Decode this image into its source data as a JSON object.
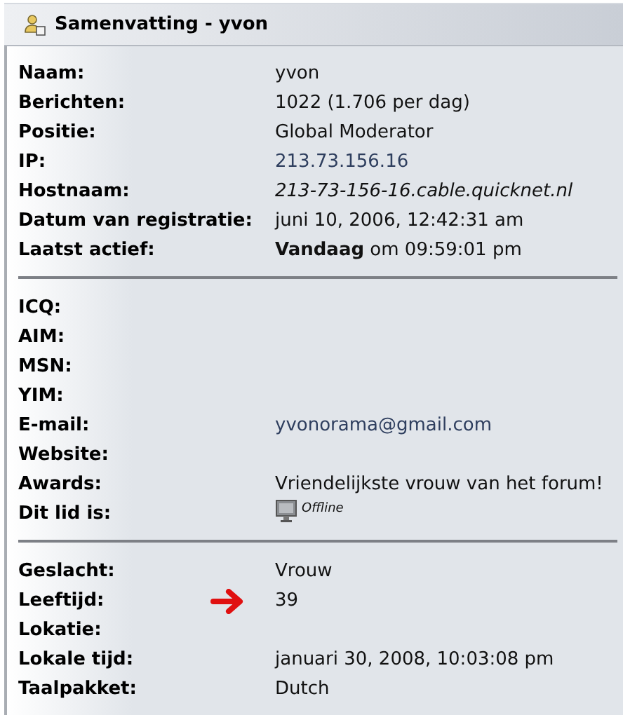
{
  "panel": {
    "title": "Samenvatting - yvon"
  },
  "sections": [
    {
      "rows": [
        {
          "label": "Naam:",
          "value": "yvon",
          "kind": "plain"
        },
        {
          "label": "Berichten:",
          "value": "1022 (1.706 per dag)",
          "kind": "plain"
        },
        {
          "label": "Positie:",
          "value": "Global Moderator",
          "kind": "plain"
        },
        {
          "label": "IP:",
          "value": "213.73.156.16",
          "kind": "link"
        },
        {
          "label": "Hostnaam:",
          "value": "213-73-156-16.cable.quicknet.nl",
          "kind": "italic"
        },
        {
          "label": "Datum van registratie:",
          "value": "juni 10, 2006, 12:42:31 am",
          "kind": "plain"
        },
        {
          "label": "Laatst actief:",
          "value": "**Vandaag** om 09:59:01 pm",
          "kind": "rich"
        }
      ]
    },
    {
      "rows": [
        {
          "label": "ICQ:",
          "kind": "plain"
        },
        {
          "label": "AIM:",
          "kind": "plain"
        },
        {
          "label": "MSN:",
          "kind": "plain"
        },
        {
          "label": "YIM:",
          "kind": "plain"
        },
        {
          "label": "E-mail:",
          "value": "yvonorama@gmail.com",
          "kind": "link"
        },
        {
          "label": "Website:",
          "kind": "plain"
        },
        {
          "label": "Awards:",
          "value": "Vriendelijkste vrouw van het forum!",
          "kind": "plain"
        },
        {
          "label": "Dit lid is:",
          "value": "Offline",
          "kind": "status"
        }
      ]
    },
    {
      "rows": [
        {
          "label": "Geslacht:",
          "value": "Vrouw",
          "kind": "plain"
        },
        {
          "label": "Leeftijd:",
          "value": "39",
          "kind": "plain",
          "arrow": true
        },
        {
          "label": "Lokatie:",
          "kind": "plain"
        },
        {
          "label": "Lokale tijd:",
          "value": "januari 30, 2008, 10:03:08 pm",
          "kind": "plain"
        },
        {
          "label": "Taalpakket:",
          "value": "Dutch",
          "kind": "plain"
        }
      ]
    }
  ]
}
